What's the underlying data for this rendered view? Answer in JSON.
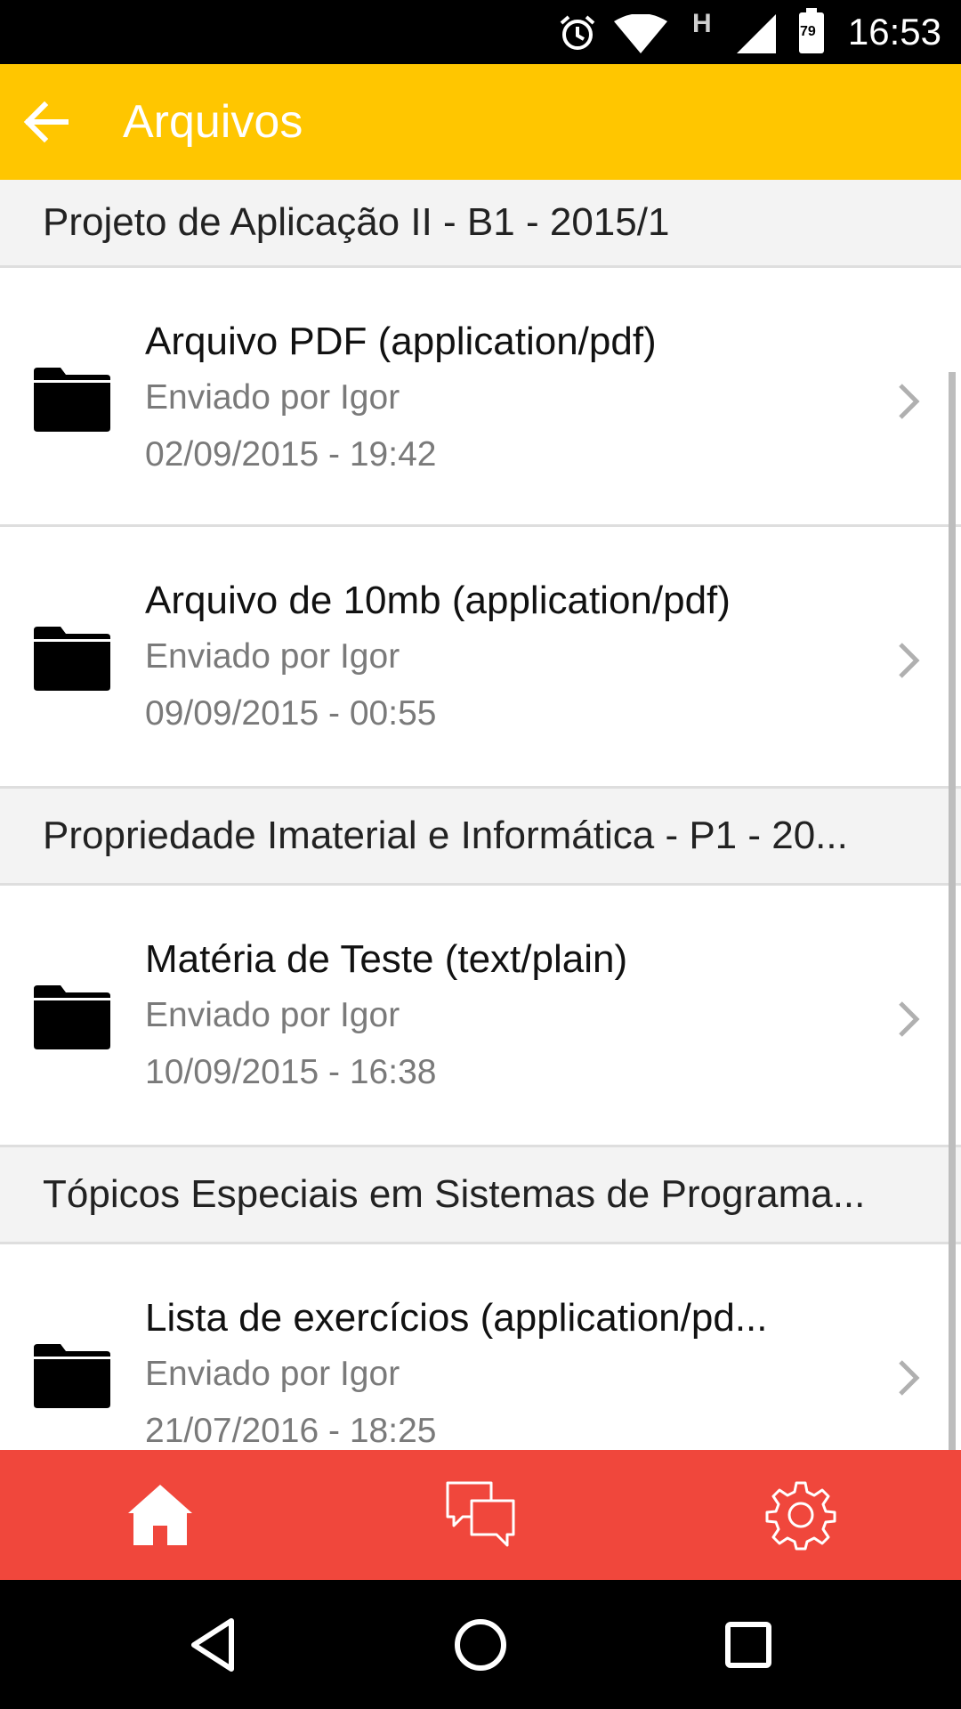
{
  "status_bar": {
    "time": "16:53",
    "battery_level": "79",
    "network_type": "H",
    "icons": [
      "alarm-icon",
      "wifi-icon",
      "signal-icon",
      "battery-icon"
    ]
  },
  "app_bar": {
    "title": "Arquivos",
    "back_icon": "arrow-left-icon",
    "color": "#ffc600"
  },
  "sections": [
    {
      "title": "Projeto de Aplicação II - B1 - 2015/1",
      "items": [
        {
          "name": "Arquivo PDF (application/pdf)",
          "sender": "Enviado por Igor",
          "date": "02/09/2015 - 19:42"
        },
        {
          "name": "Arquivo de 10mb (application/pdf)",
          "sender": "Enviado por Igor",
          "date": "09/09/2015 - 00:55"
        }
      ]
    },
    {
      "title": "Propriedade Imaterial e Informática - P1 - 20...",
      "items": [
        {
          "name": "Matéria de Teste (text/plain)",
          "sender": "Enviado por Igor",
          "date": "10/09/2015 - 16:38"
        }
      ]
    },
    {
      "title": "Tópicos Especiais em Sistemas de Programa...",
      "items": [
        {
          "name": "Lista de exercícios (application/pd...",
          "sender": "Enviado por Igor",
          "date": "21/07/2016 - 18:25"
        }
      ]
    }
  ],
  "bottom_nav": {
    "color": "#f0473c",
    "tabs": [
      "home-icon",
      "chat-icon",
      "settings-icon"
    ],
    "active": "home-icon"
  },
  "nav_bar": {
    "buttons": [
      "back-triangle-icon",
      "home-circle-icon",
      "recents-square-icon"
    ]
  }
}
